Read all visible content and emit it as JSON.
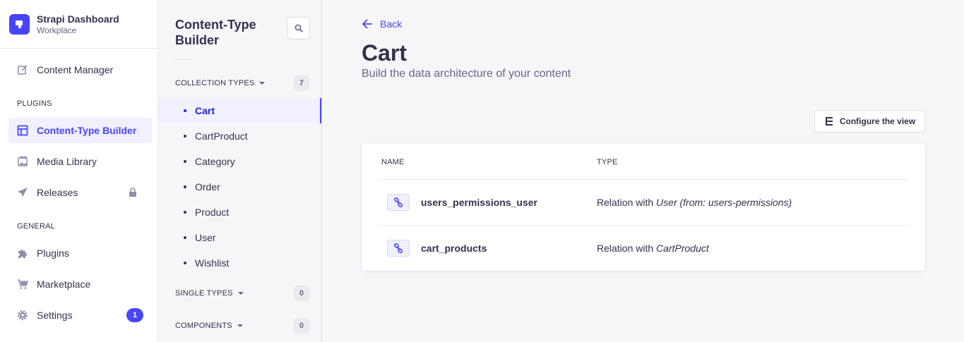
{
  "brand": {
    "title": "Strapi Dashboard",
    "subtitle": "Workplace",
    "accent": "#4945ff"
  },
  "main_nav": {
    "content_manager": "Content Manager",
    "plugins_section": "PLUGINS",
    "content_type_builder": "Content-Type Builder",
    "media_library": "Media Library",
    "releases": "Releases",
    "general_section": "GENERAL",
    "plugins": "Plugins",
    "marketplace": "Marketplace",
    "settings": "Settings",
    "settings_badge": "1"
  },
  "sub_nav": {
    "title": "Content-Type Builder",
    "collection_types": {
      "label": "COLLECTION TYPES",
      "count": "7",
      "items": [
        "Cart",
        "CartProduct",
        "Category",
        "Order",
        "Product",
        "User",
        "Wishlist"
      ],
      "active": "Cart"
    },
    "single_types": {
      "label": "SINGLE TYPES",
      "count": "0"
    },
    "components": {
      "label": "COMPONENTS",
      "count": "0"
    }
  },
  "content": {
    "back_label": "Back",
    "title": "Cart",
    "subtitle": "Build the data architecture of your content",
    "configure_label": "Configure the view",
    "table": {
      "headers": {
        "name": "NAME",
        "type": "TYPE"
      },
      "rows": [
        {
          "name": "users_permissions_user",
          "type_prefix": "Relation with ",
          "type_target": "User (from: users-permissions)",
          "icon": "relation-icon"
        },
        {
          "name": "cart_products",
          "type_prefix": "Relation with ",
          "type_target": "CartProduct",
          "icon": "relation-icon"
        }
      ]
    }
  }
}
